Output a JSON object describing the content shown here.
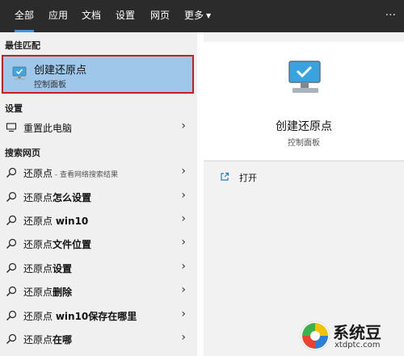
{
  "tabs": [
    {
      "label": "全部",
      "active": true
    },
    {
      "label": "应用"
    },
    {
      "label": "文档"
    },
    {
      "label": "设置"
    },
    {
      "label": "网页"
    },
    {
      "label": "更多"
    }
  ],
  "sections": {
    "best_match": "最佳匹配",
    "settings": "设置",
    "web": "搜索网页"
  },
  "best_match": {
    "title": "创建还原点",
    "subtitle": "控制面板",
    "icon": "monitor-check-icon"
  },
  "settings_items": [
    {
      "label": "重置此电脑",
      "icon": "pc-icon"
    }
  ],
  "web_items": [
    {
      "prefix": "还原点",
      "bold": "",
      "hint": " - 查看网络搜索结果"
    },
    {
      "prefix": "还原点",
      "bold": "怎么设置",
      "hint": ""
    },
    {
      "prefix": "还原点 ",
      "bold": "win10",
      "hint": ""
    },
    {
      "prefix": "还原点",
      "bold": "文件位置",
      "hint": ""
    },
    {
      "prefix": "还原点",
      "bold": "设置",
      "hint": ""
    },
    {
      "prefix": "还原点",
      "bold": "删除",
      "hint": ""
    },
    {
      "prefix": "还原点 ",
      "bold": "win10保存在哪里",
      "hint": ""
    },
    {
      "prefix": "还原点",
      "bold": "在哪",
      "hint": ""
    }
  ],
  "detail": {
    "title": "创建还原点",
    "subtitle": "控制面板",
    "action_label": "打开"
  },
  "watermark": {
    "name": "系统豆",
    "url": "xtdptc.com"
  },
  "colors": {
    "topbar": "#2b2b2b",
    "accent": "#4a90d9",
    "selection": "#9ec7ea",
    "highlight_border": "#d11a1a"
  }
}
